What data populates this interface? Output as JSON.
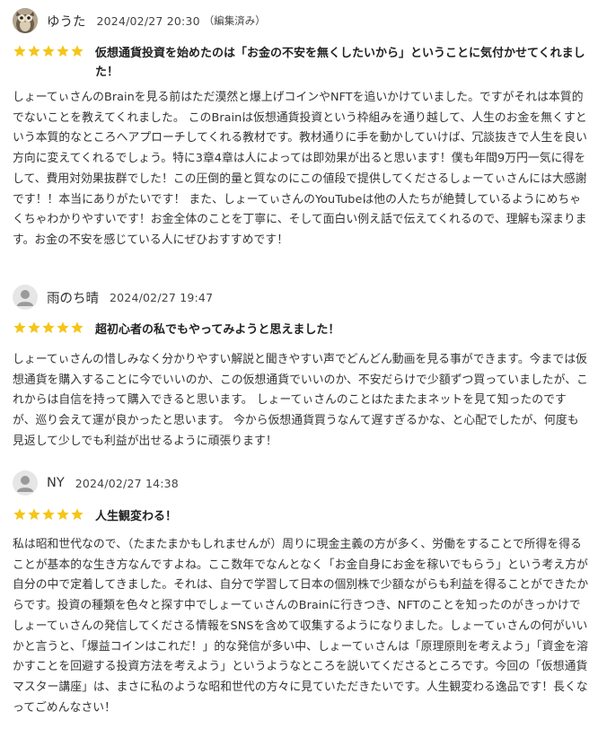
{
  "colors": {
    "star": "#f5c518",
    "text": "#333333",
    "avatar_bg": "#e6e6e6",
    "avatar_fg": "#9a9a9a"
  },
  "reviews": [
    {
      "avatar_icon": "owl-photo-icon",
      "username": "ゆうた",
      "datetime": "2024/02/27 20:30",
      "edited": "（編集済み）",
      "rating": 5,
      "title": "仮想通貨投資を始めたのは「お金の不安を無くしたいから」ということに気付かせてくれました！",
      "body": "しょーてぃさんのBrainを見る前はただ漠然と爆上げコインやNFTを追いかけていました。ですがそれは本質的でないことを教えてくれました。 このBrainは仮想通貨投資という枠組みを通り越して、人生のお金を無くすという本質的なところへアプローチしてくれる教材です。教材通りに手を動かしていけば、冗談抜きで人生を良い方向に変えてくれるでしょう。特に3章4章は人によっては即効果が出ると思います！僕も年間9万円一気に得をして、費用対効果抜群でした！この圧倒的量と質なのにこの値段で提供してくださるしょーてぃさんには大感謝です！！本当にありがたいです！ また、しょーてぃさんのYouTubeは他の人たちが絶賛しているようにめちゃくちゃわかりやすいです！お金全体のことを丁寧に、そして面白い例え話で伝えてくれるので、理解も深まります。お金の不安を感じている人にぜひおすすめです！"
    },
    {
      "avatar_icon": "default-user-icon",
      "username": "雨のち晴",
      "datetime": "2024/02/27 19:47",
      "edited": "",
      "rating": 5,
      "title": "超初心者の私でもやってみようと思えました！",
      "body": "しょーてぃさんの惜しみなく分かりやすい解説と聞きやすい声でどんどん動画を見る事ができます。今までは仮想通貨を購入することに今でいいのか、この仮想通貨でいいのか、不安だらけで少額ずつ買っていましたが、これからは自信を持って購入できると思います。 しょーてぃさんのことはたまたまネットを見て知ったのですが、巡り会えて運が良かったと思います。 今から仮想通貨買うなんて遅すぎるかな、と心配でしたが、何度も見返して少しでも利益が出せるように頑張ります！"
    },
    {
      "avatar_icon": "default-user-icon",
      "username": "NY",
      "datetime": "2024/02/27 14:38",
      "edited": "",
      "rating": 5,
      "title": "人生観変わる！",
      "body": "私は昭和世代なので、（たまたまかもしれませんが）周りに現金主義の方が多く、労働をすることで所得を得ることが基本的な生き方なんですよね。ここ数年でなんとなく「お金自身にお金を稼いでもらう」という考え方が自分の中で定着してきました。それは、自分で学習して日本の個別株で少額ながらも利益を得ることができたからです。投資の種類を色々と探す中でしょーてぃさんのBrainに行きつき、NFTのことを知ったのがきっかけでしょーてぃさんの発信してくださる情報をSNSを含めて収集するようになりました。しょーてぃさんの何がいいかと言うと、「爆益コインはこれだ！」的な発信が多い中、しょーてぃさんは「原理原則を考えよう」「資金を溶かすことを回避する投資方法を考えよう」というようなところを説いてくださるところです。今回の「仮想通貨マスター講座」は、まさに私のような昭和世代の方々に見ていただきたいです。人生観変わる逸品です！長くなってごめんなさい！"
    }
  ]
}
